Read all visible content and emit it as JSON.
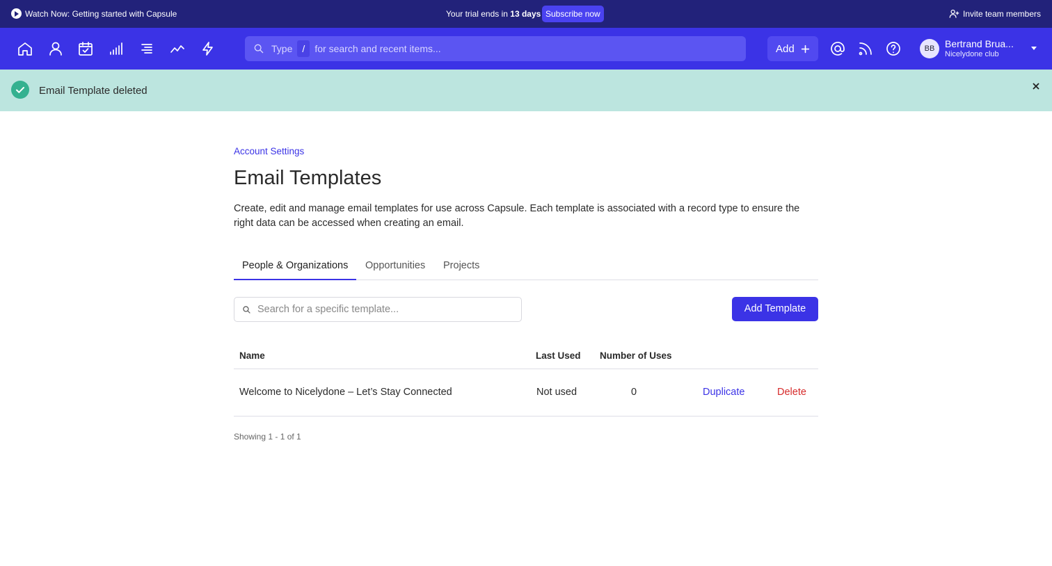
{
  "promo": {
    "watch_label": "Watch Now: Getting started with Capsule",
    "trial_prefix": "Your trial ends in",
    "trial_days": "13 days",
    "subscribe_label": "Subscribe now",
    "invite_label": "Invite team members"
  },
  "nav": {
    "icons": [
      "home-icon",
      "person-icon",
      "calendar-check-icon",
      "bar-chart-icon",
      "list-icon",
      "trend-line-icon",
      "lightning-icon",
      "at-sign-icon",
      "rss-icon",
      "help-icon"
    ],
    "search": {
      "prefix": "Type",
      "shortcut": "/",
      "suffix": "for search and recent items..."
    },
    "add_label": "Add",
    "user": {
      "initials": "BB",
      "name": "Bertrand Brua...",
      "org": "Nicelydone club"
    }
  },
  "notification": {
    "message": "Email Template deleted",
    "color": "#bce5df"
  },
  "breadcrumb": "Account Settings",
  "page_title": "Email Templates",
  "description": "Create, edit and manage email templates for use across Capsule. Each template is associated with a record type to ensure the right data can be accessed when creating an email.",
  "tabs": [
    {
      "label": "People & Organizations",
      "active": true
    },
    {
      "label": "Opportunities",
      "active": false
    },
    {
      "label": "Projects",
      "active": false
    }
  ],
  "template_search": {
    "placeholder": "Search for a specific template..."
  },
  "add_template_label": "Add Template",
  "table": {
    "columns": [
      "Name",
      "Last Used",
      "Number of Uses"
    ],
    "rows": [
      {
        "name": "Welcome to Nicelydone – Let’s Stay Connected",
        "last_used": "Not used",
        "uses": "0",
        "duplicate_label": "Duplicate",
        "delete_label": "Delete"
      }
    ]
  },
  "pagination": "Showing 1 - 1 of 1",
  "colors": {
    "promo_bar": "#22227a",
    "nav_bar": "#3b33e6",
    "accent": "#3b33e6",
    "danger": "#d62a2a"
  }
}
